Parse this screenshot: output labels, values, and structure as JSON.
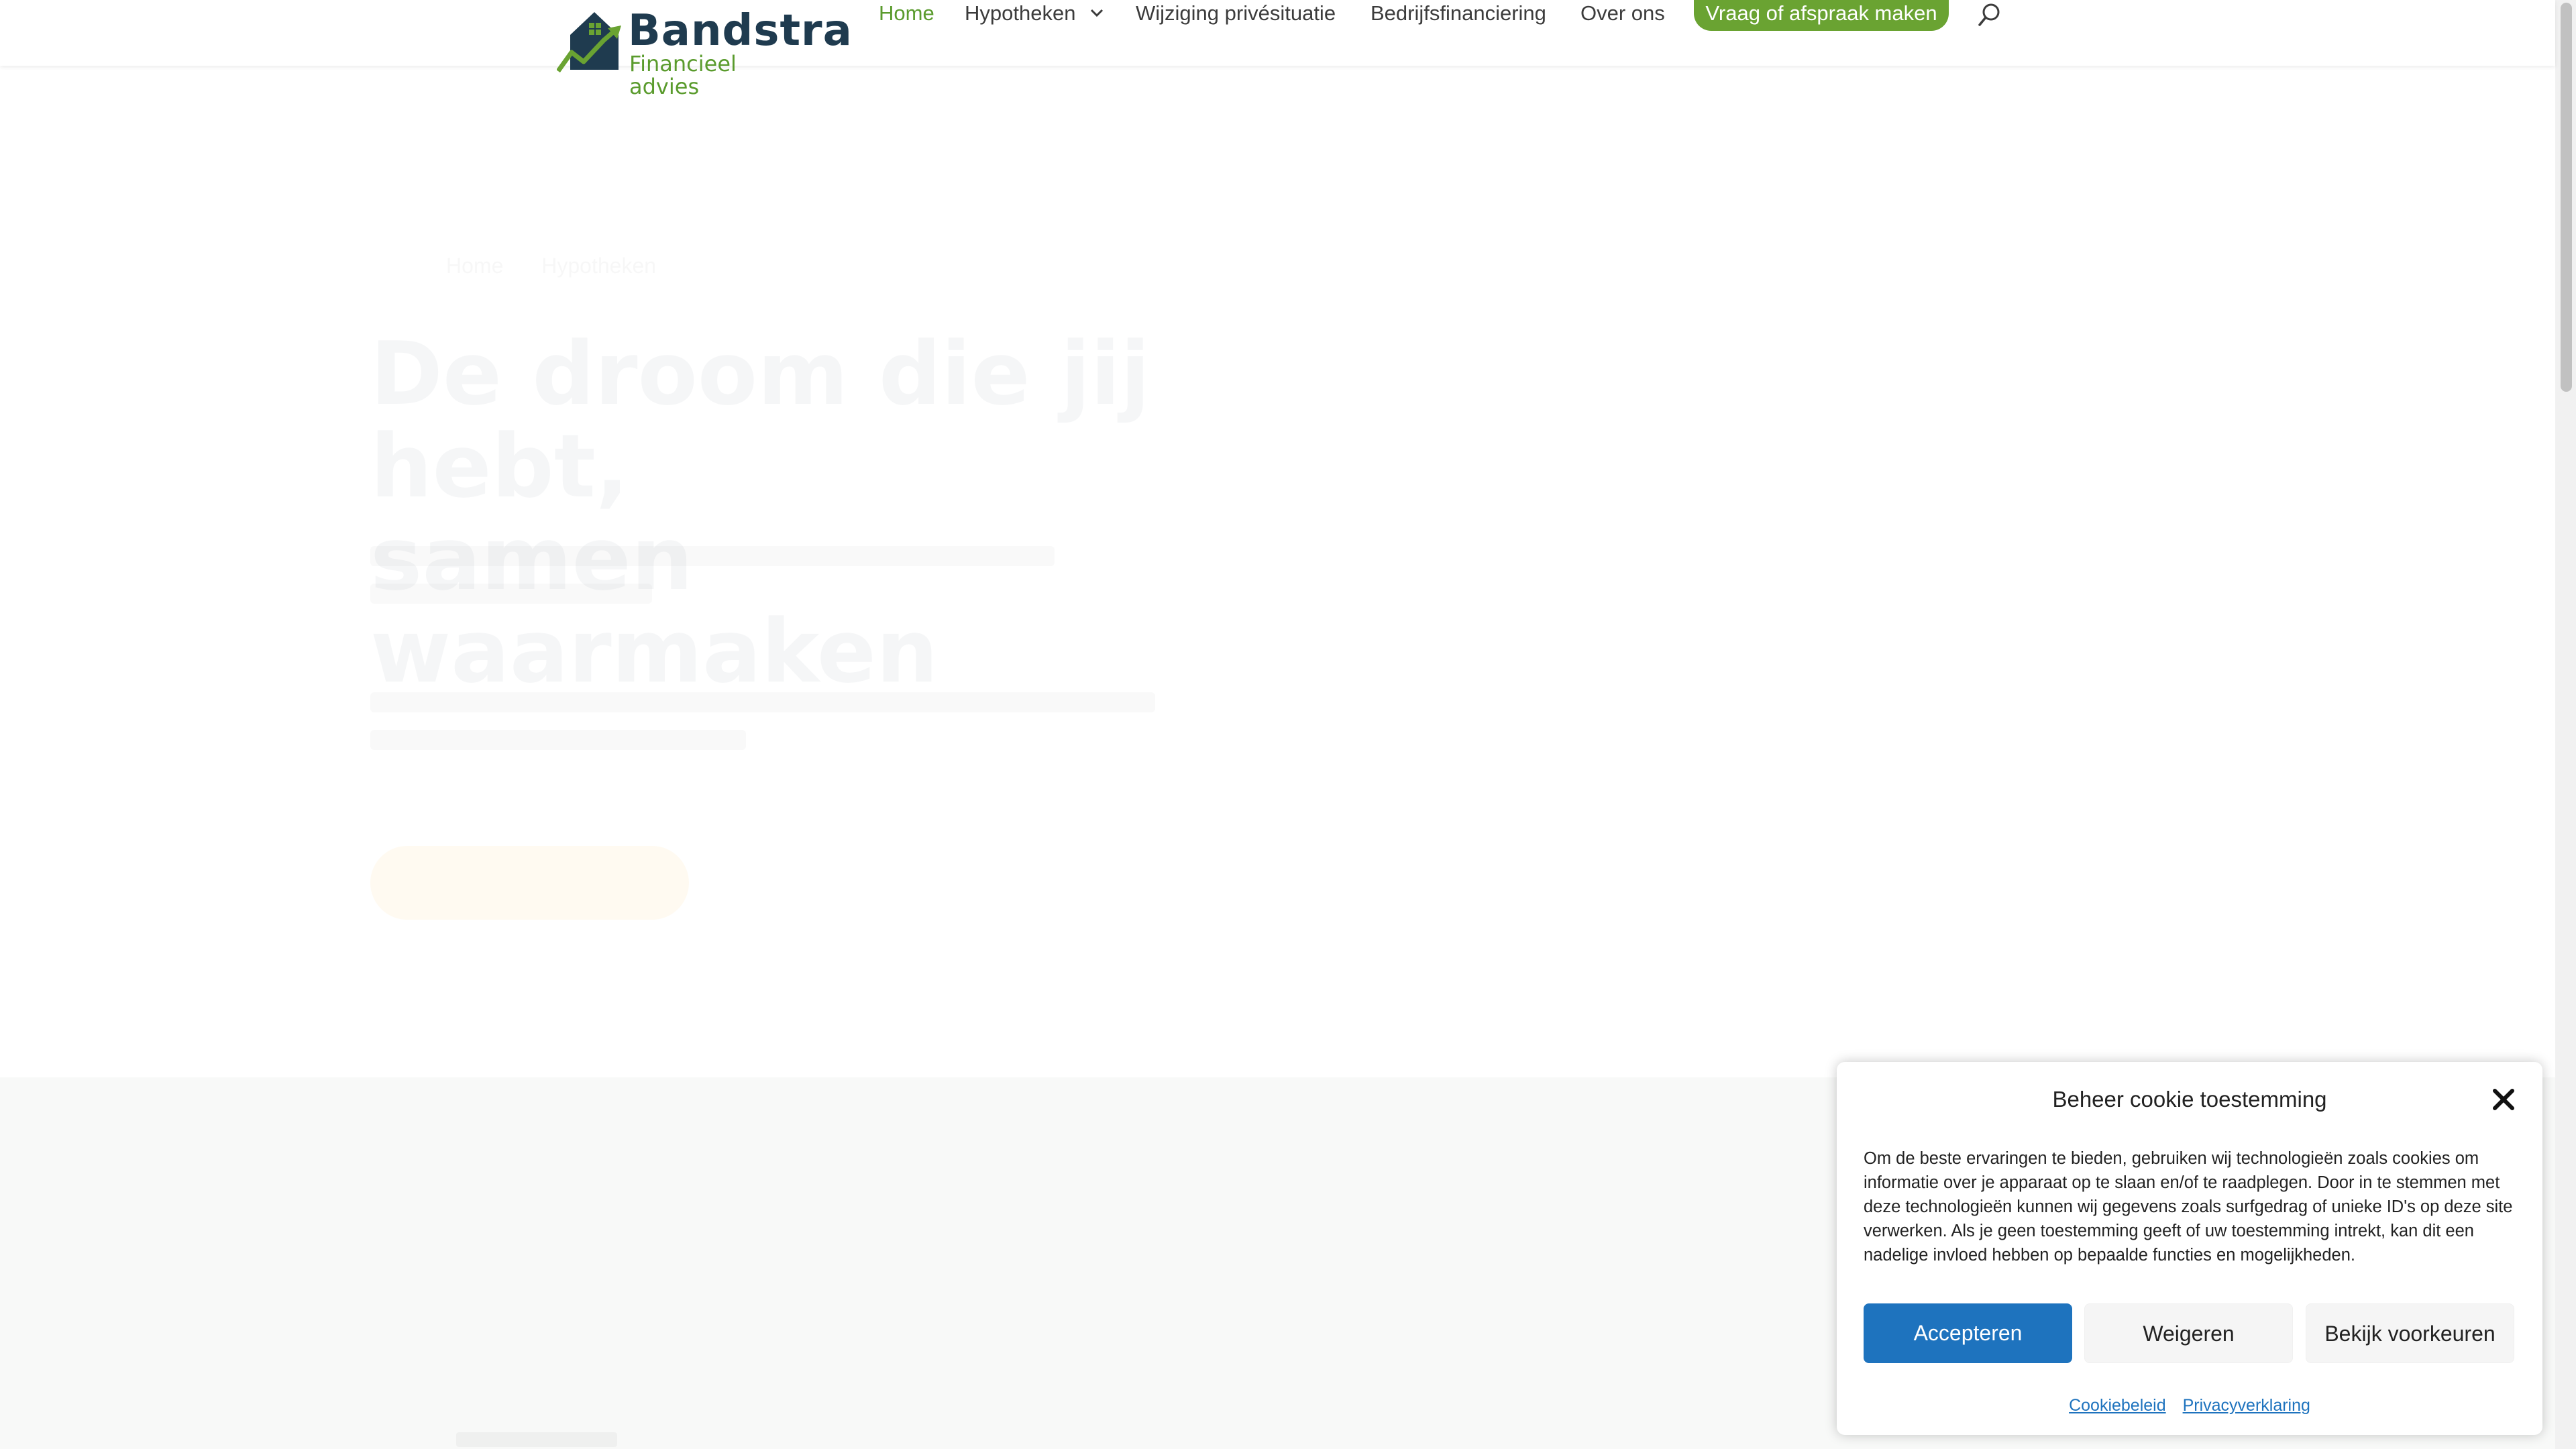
{
  "brand": {
    "name": "Bandstra",
    "tagline": "Financieel advies",
    "colors": {
      "green": "#6aa332",
      "navy": "#1f3b4f",
      "accept_blue": "#1e73be"
    },
    "icon": "house-chart-icon"
  },
  "nav": {
    "items": [
      {
        "label": "Home",
        "active": true
      },
      {
        "label": "Hypotheken",
        "has_submenu": true,
        "icon": "chevron-down-icon"
      },
      {
        "label": "Wijziging privésituatie"
      },
      {
        "label": "Bedrijfsfinanciering"
      },
      {
        "label": "Over ons"
      }
    ],
    "cta_label": "Vraag of afspraak maken",
    "search_icon": "search-icon"
  },
  "hero": {
    "breadcrumbs": [
      "Home",
      "Hypotheken"
    ],
    "title_line1": "De droom die jij hebt,",
    "title_line2": "samen waarmaken"
  },
  "cookie": {
    "title": "Beheer cookie toestemming",
    "close_icon": "close-icon",
    "body": "Om de beste ervaringen te bieden, gebruiken wij technologieën zoals cookies om informatie over je apparaat op te slaan en/of te raadplegen. Door in te stemmen met deze technologieën kunnen wij gegevens zoals surfgedrag of unieke ID's op deze site verwerken. Als je geen toestemming geeft of uw toestemming intrekt, kan dit een nadelige invloed hebben op bepaalde functies en mogelijkheden.",
    "accept_label": "Accepteren",
    "deny_label": "Weigeren",
    "prefs_label": "Bekijk voorkeuren",
    "links": [
      "Cookiebeleid",
      "Privacyverklaring"
    ]
  }
}
